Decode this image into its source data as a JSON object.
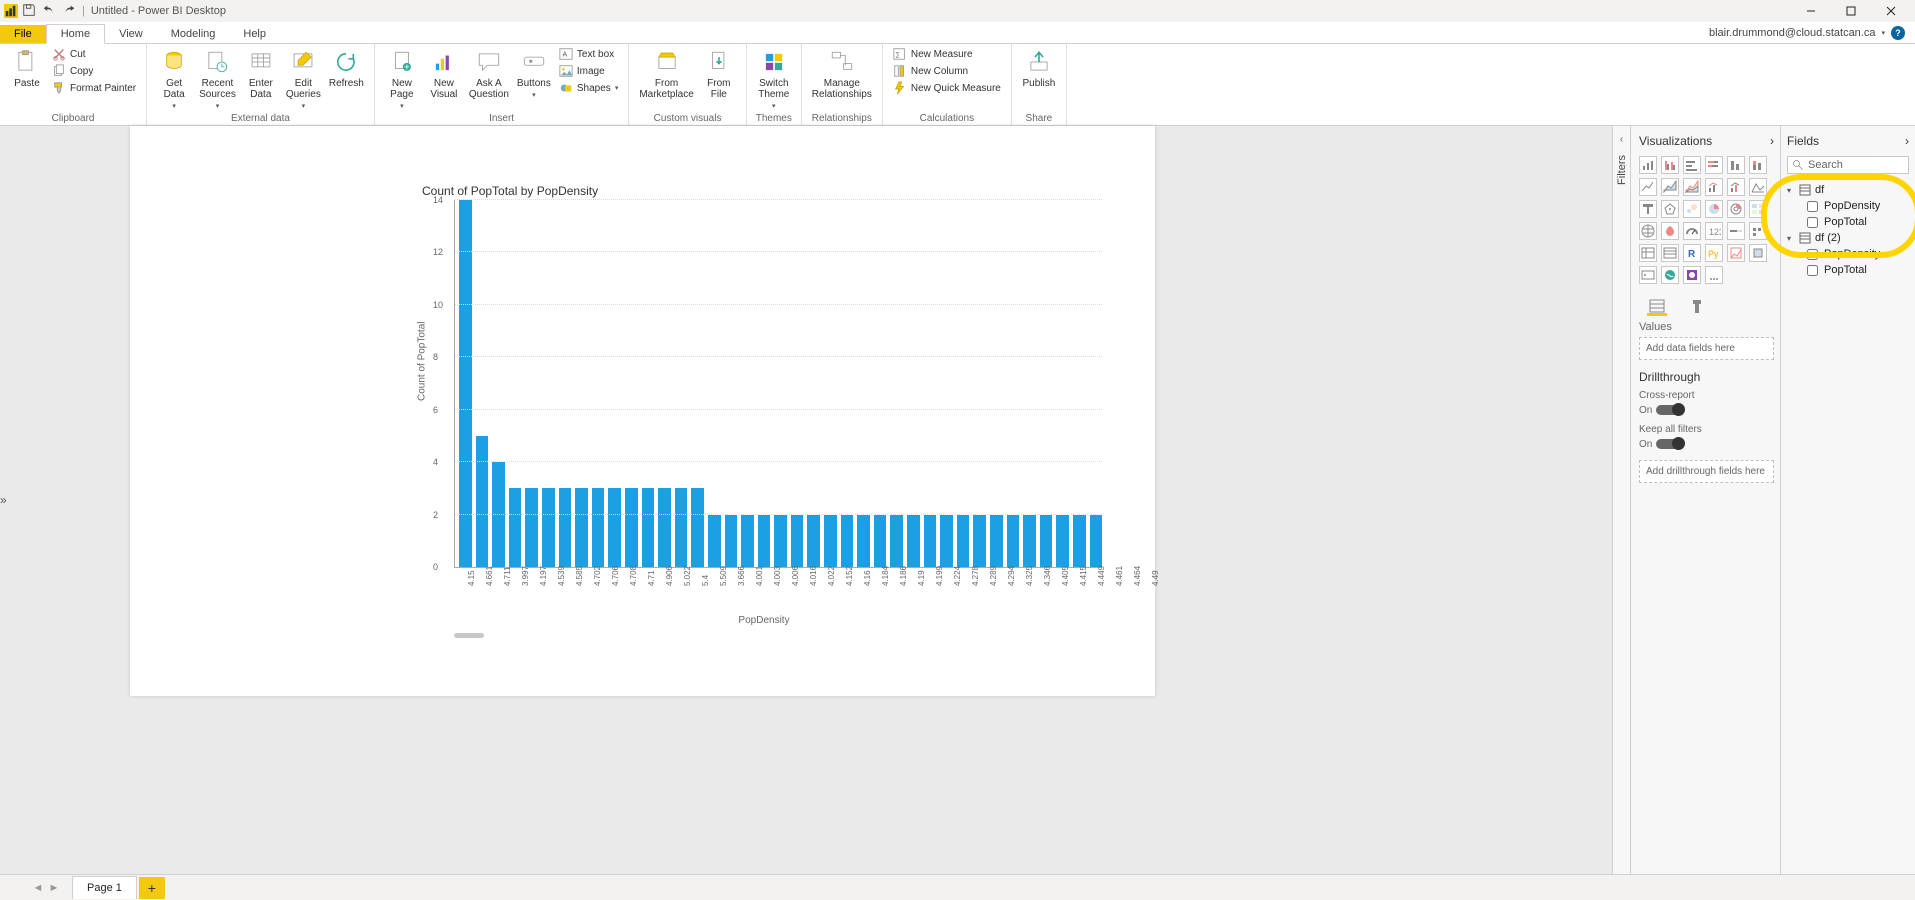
{
  "title_bar": {
    "app_title": "Untitled - Power BI Desktop"
  },
  "menu": {
    "file": "File",
    "tabs": [
      "Home",
      "View",
      "Modeling",
      "Help"
    ],
    "active": "Home",
    "account": "blair.drummond@cloud.statcan.ca"
  },
  "ribbon": {
    "clipboard": {
      "paste": "Paste",
      "cut": "Cut",
      "copy": "Copy",
      "format_painter": "Format Painter",
      "label": "Clipboard"
    },
    "external": {
      "get_data": "Get\nData",
      "recent_sources": "Recent\nSources",
      "enter_data": "Enter\nData",
      "edit_queries": "Edit\nQueries",
      "refresh": "Refresh",
      "label": "External data"
    },
    "insert": {
      "new_page": "New\nPage",
      "new_visual": "New\nVisual",
      "ask_a_question": "Ask A\nQuestion",
      "buttons": "Buttons",
      "text_box": "Text box",
      "image": "Image",
      "shapes": "Shapes",
      "label": "Insert"
    },
    "custom_visuals": {
      "from_marketplace": "From\nMarketplace",
      "from_file": "From\nFile",
      "label": "Custom visuals"
    },
    "themes": {
      "switch_theme": "Switch\nTheme",
      "label": "Themes"
    },
    "relationships": {
      "manage": "Manage\nRelationships",
      "label": "Relationships"
    },
    "calculations": {
      "new_measure": "New Measure",
      "new_column": "New Column",
      "new_quick_measure": "New Quick Measure",
      "label": "Calculations"
    },
    "share": {
      "publish": "Publish",
      "label": "Share"
    }
  },
  "filters_label": "Filters",
  "visualizations": {
    "header": "Visualizations",
    "values_label": "Values",
    "values_placeholder": "Add data fields here",
    "drillthrough": "Drillthrough",
    "cross_report": "Cross-report",
    "cross_report_state": "On",
    "keep_filters": "Keep all filters",
    "keep_filters_state": "On",
    "drill_placeholder": "Add drillthrough fields here"
  },
  "fields": {
    "header": "Fields",
    "search_placeholder": "Search",
    "tables": [
      {
        "name": "df",
        "columns": [
          "PopDensity",
          "PopTotal"
        ]
      },
      {
        "name": "df (2)",
        "columns": [
          "PopDensity",
          "PopTotal"
        ]
      }
    ]
  },
  "page_tabs": {
    "page1": "Page 1"
  },
  "chart_data": {
    "type": "bar",
    "title": "Count of PopTotal by PopDensity",
    "xlabel": "PopDensity",
    "ylabel": "Count of PopTotal",
    "ylim": [
      0,
      14
    ],
    "yticks": [
      0,
      2,
      4,
      6,
      8,
      10,
      12,
      14
    ],
    "categories": [
      "4.15",
      "4.661",
      "4.711",
      "3.997",
      "4.197",
      "4.539",
      "4.585",
      "4.702",
      "4.706",
      "4.708",
      "4.71",
      "4.906",
      "5.022",
      "5.4",
      "5.509",
      "3.666",
      "4.001",
      "4.003",
      "4.006",
      "4.016",
      "4.022",
      "4.152",
      "4.16",
      "4.184",
      "4.186",
      "4.19",
      "4.199",
      "4.224",
      "4.278",
      "4.289",
      "4.294",
      "4.325",
      "4.346",
      "4.405",
      "4.415",
      "4.449",
      "4.461",
      "4.464",
      "4.49"
    ],
    "values": [
      14,
      5,
      4,
      3,
      3,
      3,
      3,
      3,
      3,
      3,
      3,
      3,
      3,
      3,
      3,
      2,
      2,
      2,
      2,
      2,
      2,
      2,
      2,
      2,
      2,
      2,
      2,
      2,
      2,
      2,
      2,
      2,
      2,
      2,
      2,
      2,
      2,
      2,
      2
    ]
  }
}
